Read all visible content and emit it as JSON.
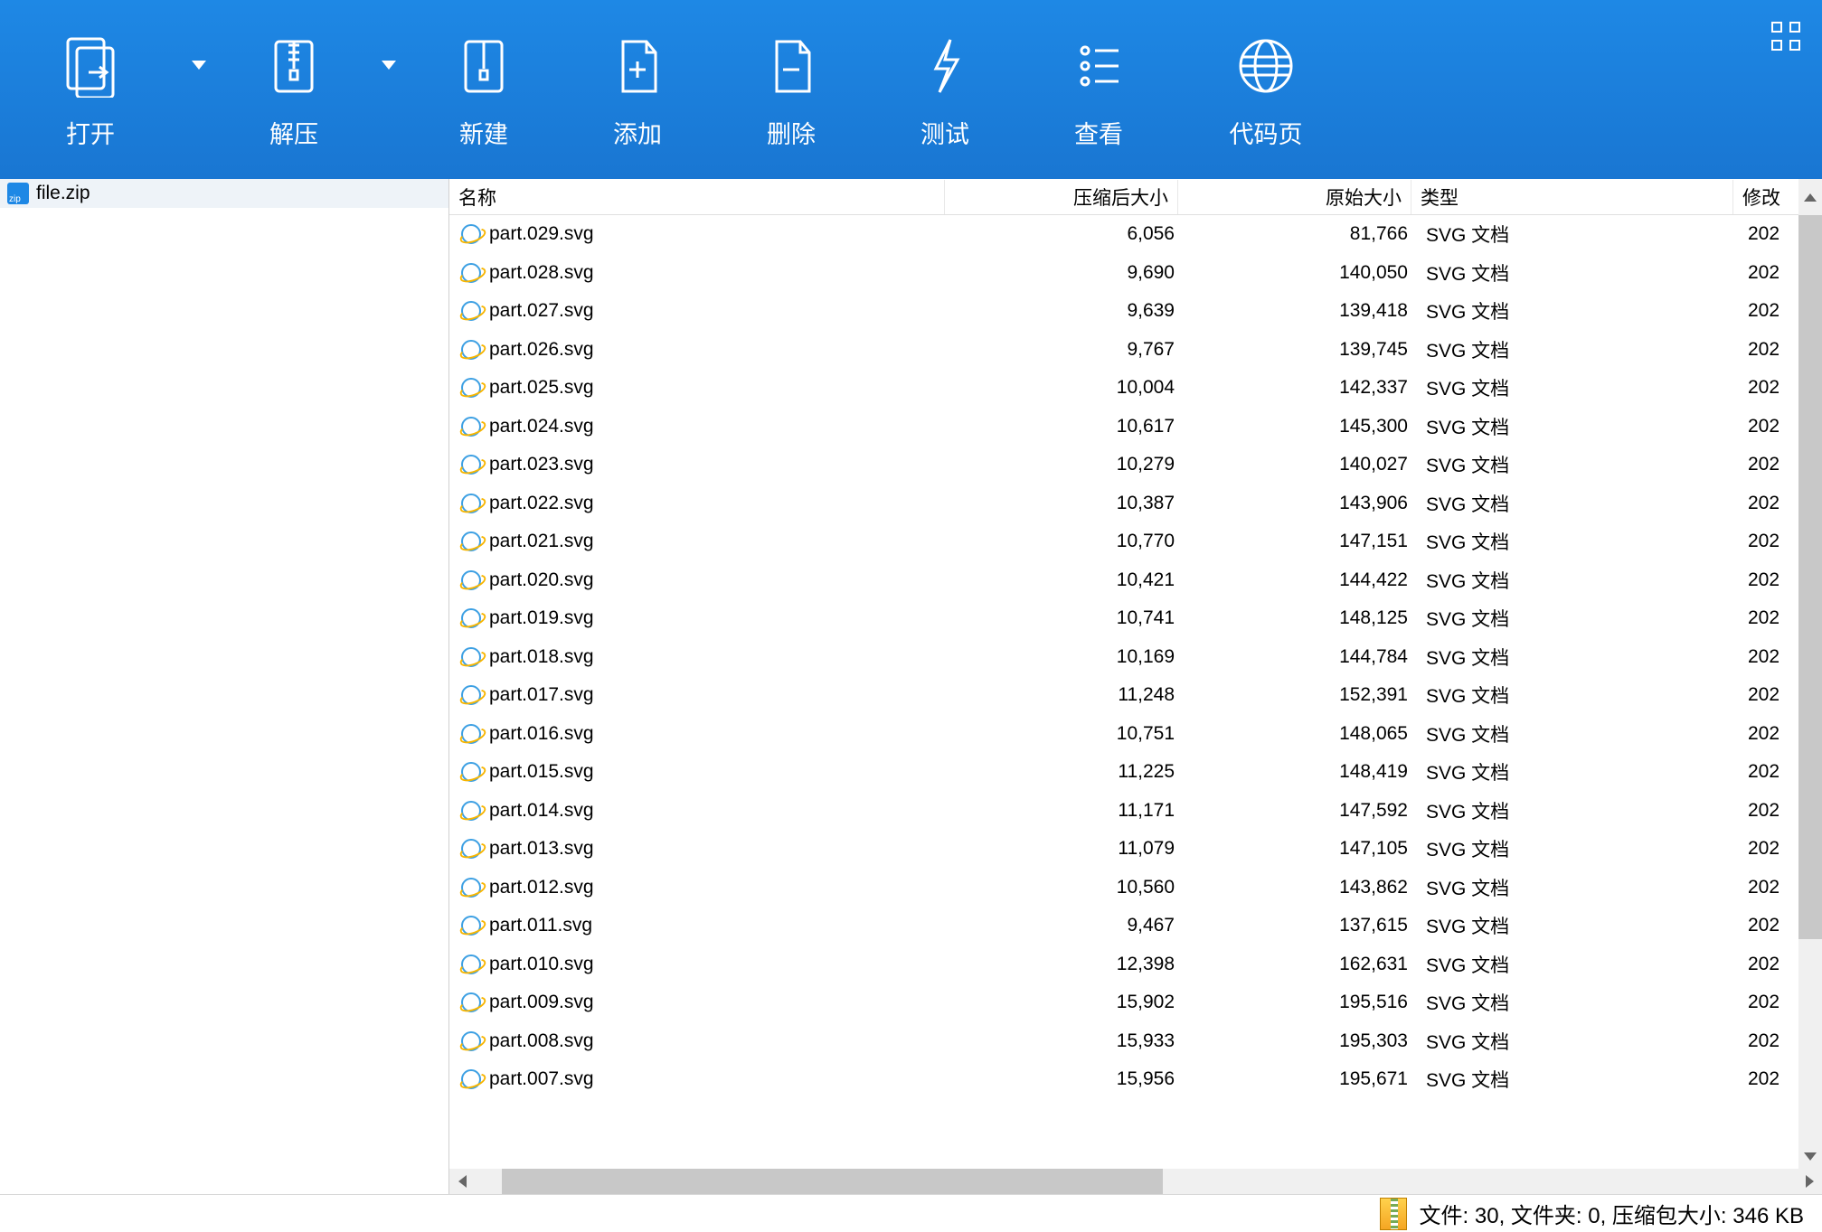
{
  "toolbar": {
    "open": "打开",
    "extract": "解压",
    "new": "新建",
    "add": "添加",
    "delete": "删除",
    "test": "测试",
    "view": "查看",
    "codepage": "代码页"
  },
  "tree": {
    "filename": "file.zip"
  },
  "columns": {
    "name": "名称",
    "packed": "压缩后大小",
    "original": "原始大小",
    "type": "类型",
    "modified": "修改"
  },
  "filetype": "SVG 文档",
  "mod_trunc": "202",
  "files": [
    {
      "name": "part.029.svg",
      "packed": "6,056",
      "orig": "81,766"
    },
    {
      "name": "part.028.svg",
      "packed": "9,690",
      "orig": "140,050"
    },
    {
      "name": "part.027.svg",
      "packed": "9,639",
      "orig": "139,418"
    },
    {
      "name": "part.026.svg",
      "packed": "9,767",
      "orig": "139,745"
    },
    {
      "name": "part.025.svg",
      "packed": "10,004",
      "orig": "142,337"
    },
    {
      "name": "part.024.svg",
      "packed": "10,617",
      "orig": "145,300"
    },
    {
      "name": "part.023.svg",
      "packed": "10,279",
      "orig": "140,027"
    },
    {
      "name": "part.022.svg",
      "packed": "10,387",
      "orig": "143,906"
    },
    {
      "name": "part.021.svg",
      "packed": "10,770",
      "orig": "147,151"
    },
    {
      "name": "part.020.svg",
      "packed": "10,421",
      "orig": "144,422"
    },
    {
      "name": "part.019.svg",
      "packed": "10,741",
      "orig": "148,125"
    },
    {
      "name": "part.018.svg",
      "packed": "10,169",
      "orig": "144,784"
    },
    {
      "name": "part.017.svg",
      "packed": "11,248",
      "orig": "152,391"
    },
    {
      "name": "part.016.svg",
      "packed": "10,751",
      "orig": "148,065"
    },
    {
      "name": "part.015.svg",
      "packed": "11,225",
      "orig": "148,419"
    },
    {
      "name": "part.014.svg",
      "packed": "11,171",
      "orig": "147,592"
    },
    {
      "name": "part.013.svg",
      "packed": "11,079",
      "orig": "147,105"
    },
    {
      "name": "part.012.svg",
      "packed": "10,560",
      "orig": "143,862"
    },
    {
      "name": "part.011.svg",
      "packed": "9,467",
      "orig": "137,615"
    },
    {
      "name": "part.010.svg",
      "packed": "12,398",
      "orig": "162,631"
    },
    {
      "name": "part.009.svg",
      "packed": "15,902",
      "orig": "195,516"
    },
    {
      "name": "part.008.svg",
      "packed": "15,933",
      "orig": "195,303"
    },
    {
      "name": "part.007.svg",
      "packed": "15,956",
      "orig": "195,671"
    }
  ],
  "status": {
    "text": "文件: 30, 文件夹: 0, 压缩包大小: 346 KB"
  }
}
